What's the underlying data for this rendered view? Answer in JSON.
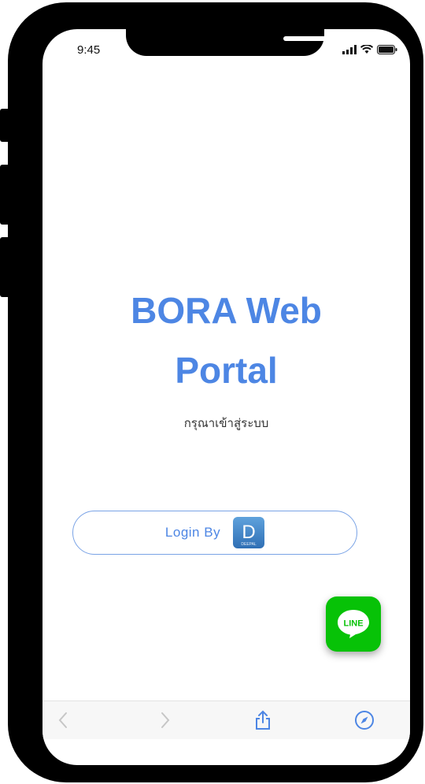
{
  "status_bar": {
    "time": "9:45"
  },
  "portal": {
    "title_line1": "BORA Web",
    "title_line2": "Portal",
    "subtitle": "กรุณาเข้าสู่ระบบ"
  },
  "login": {
    "label": "Login By",
    "logo_letter": "D",
    "logo_caption": "DEEPAL"
  },
  "line_widget": {
    "label": "LINE",
    "color": "#07c207"
  },
  "browser_toolbar": {
    "items": [
      "back-icon",
      "forward-icon",
      "share-icon",
      "compass-icon"
    ]
  },
  "colors": {
    "accent": "#4d86e4",
    "line_green": "#07c207"
  }
}
